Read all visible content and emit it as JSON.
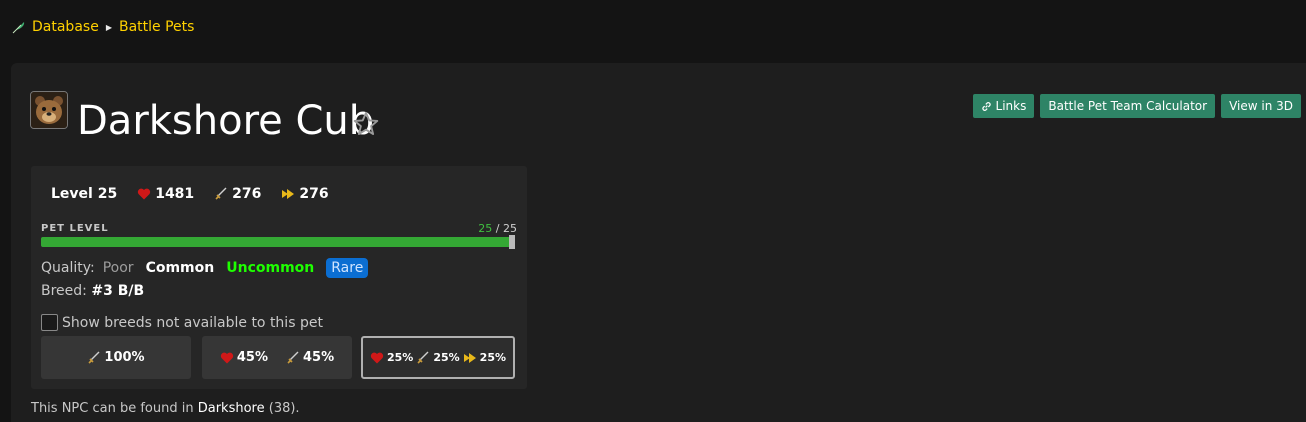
{
  "breadcrumb": {
    "items": [
      "Database",
      "Battle Pets"
    ]
  },
  "pet": {
    "name": "Darkshore Cub"
  },
  "actions": {
    "links": "Links",
    "calculator": "Battle Pet Team Calculator",
    "view3d": "View in 3D"
  },
  "stats": {
    "level": "Level 25",
    "health": "1481",
    "power": "276",
    "speed": "276"
  },
  "pet_level": {
    "label": "PET LEVEL",
    "current": "25",
    "sep": " / ",
    "max": "25",
    "progress_fraction": 1.0
  },
  "quality": {
    "label": "Quality:",
    "options": [
      "Poor",
      "Common",
      "Uncommon",
      "Rare"
    ],
    "selected": "Rare"
  },
  "breed": {
    "label": "Breed:",
    "value": "#3 B/B"
  },
  "breed_toggle": {
    "label": "Show breeds not available to this pet",
    "checked": false
  },
  "breed_options": [
    {
      "power": "100%"
    },
    {
      "health": "45%",
      "power": "45%"
    },
    {
      "health": "25%",
      "power": "25%",
      "speed": "25%",
      "selected": true
    }
  ],
  "location": {
    "prefix": "This NPC can be found in",
    "zone": "Darkshore",
    "count": "(38)."
  },
  "colors": {
    "accent_green": "#2e8466",
    "breadcrumb": "#ffd100",
    "rare": "#0b6ed2",
    "uncommon": "#1eff00"
  }
}
